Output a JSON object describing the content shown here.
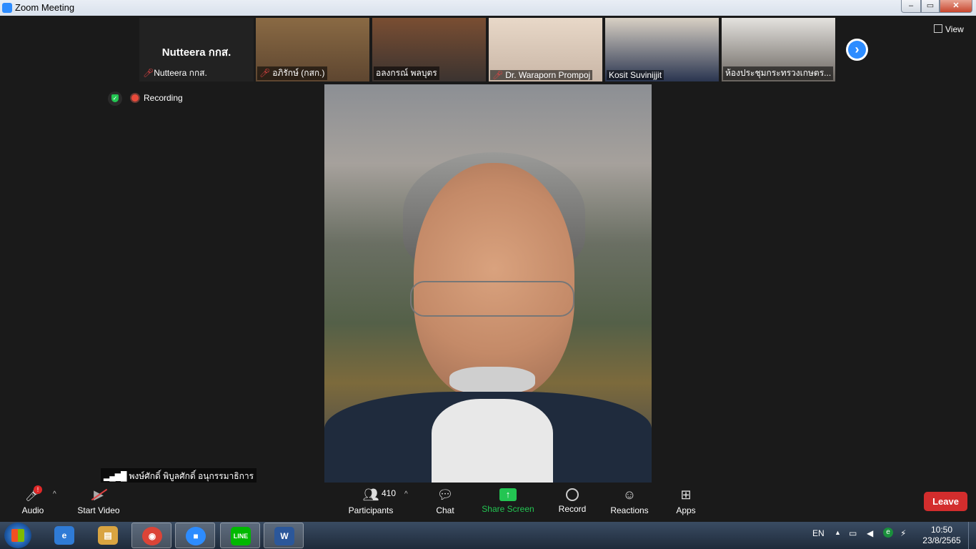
{
  "window": {
    "title": "Zoom Meeting",
    "min": "–",
    "max": "▭",
    "close": "✕"
  },
  "gallery": {
    "name_only_big": "Nutteera กกส.",
    "name_only_label": "Nutteera กกส.",
    "thumbs": [
      {
        "label": "อภิรักษ์ (กสก.)",
        "muted": true
      },
      {
        "label": "อลงกรณ์ พลบุตร",
        "muted": false
      },
      {
        "label": "Dr. Waraporn Prompoj",
        "muted": true
      },
      {
        "label": "Kosit Suvinijjit",
        "muted": false
      },
      {
        "label": "ห้องประชุมกระทรวงเกษตร...",
        "muted": false
      }
    ],
    "next_icon": "›",
    "view_label": "View"
  },
  "status": {
    "recording_label": "Recording",
    "security_icon": "✓"
  },
  "speaker": {
    "name": "พงษ์ศักดิ์ พิบูลศักดิ์ อนุกรรมาธิการ",
    "signal": "▂▄▆█"
  },
  "toolbar": {
    "audio_label": "Audio",
    "audio_badge": "!",
    "video_label": "Start Video",
    "participants_label": "Participants",
    "participants_count": "410",
    "chat_label": "Chat",
    "share_label": "Share Screen",
    "record_label": "Record",
    "reactions_label": "Reactions",
    "apps_label": "Apps",
    "leave_label": "Leave",
    "caret": "^"
  },
  "taskbar": {
    "apps": [
      {
        "name": "ie",
        "glyph": "e",
        "color": "#2f7bd6"
      },
      {
        "name": "explorer",
        "glyph": "▤",
        "color": "#d9a441"
      },
      {
        "name": "chrome",
        "glyph": "◉",
        "color": "#db4437"
      },
      {
        "name": "zoom",
        "glyph": "■",
        "color": "#2d8cff"
      },
      {
        "name": "line",
        "glyph": "LINE",
        "color": "#00b900"
      },
      {
        "name": "word",
        "glyph": "W",
        "color": "#2b579a"
      }
    ],
    "lang": "EN",
    "time": "10:50",
    "date": "23/8/2565"
  }
}
